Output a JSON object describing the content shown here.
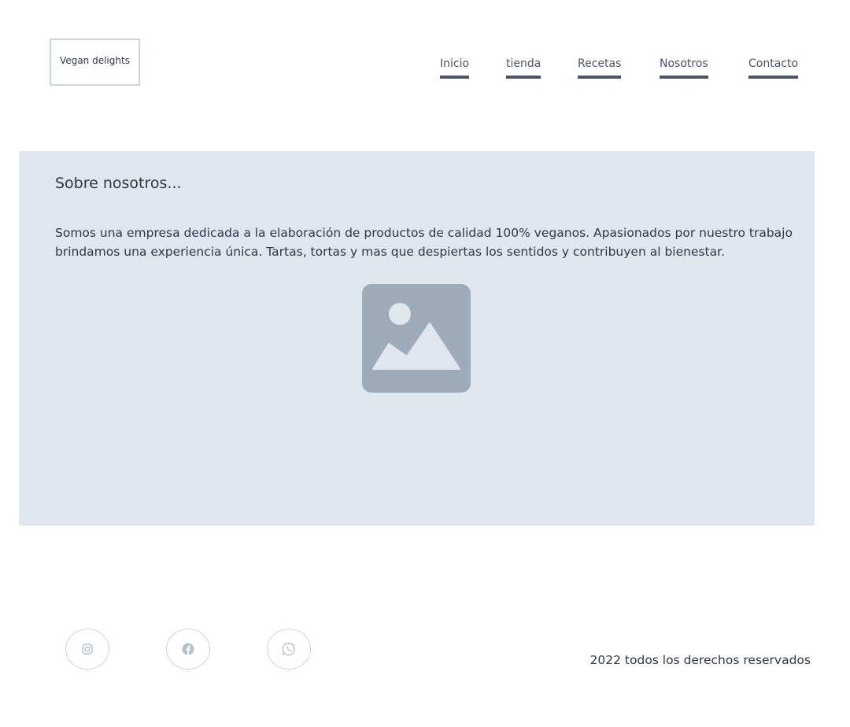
{
  "header": {
    "logo_text": "Vegan delights",
    "nav": [
      {
        "label": "Inicio"
      },
      {
        "label": "tienda"
      },
      {
        "label": "Recetas"
      },
      {
        "label": "Nosotros"
      },
      {
        "label": "Contacto"
      }
    ]
  },
  "about": {
    "title": "Sobre nosotros...",
    "text": "Somos una empresa dedicada a la elaboración de productos de calidad 100% veganos. Apasionados por nuestro trabajo brindamos una experiencia única. Tartas, tortas y mas que despiertas los sentidos y contribuyen al bienestar.",
    "image_icon": "image-placeholder-icon"
  },
  "footer": {
    "social": [
      {
        "icon": "instagram-icon"
      },
      {
        "icon": "facebook-icon"
      },
      {
        "icon": "whatsapp-icon"
      }
    ],
    "copyright": "2022 todos los derechos reservados"
  },
  "colors": {
    "section_bg": "#e0e6ee",
    "nav_underline": "#4a5568",
    "placeholder": "#9eacb9",
    "border": "#cbd5e0"
  }
}
